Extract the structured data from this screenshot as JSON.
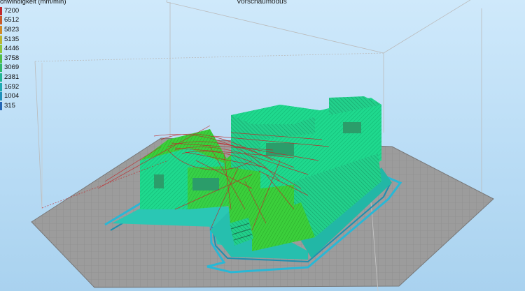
{
  "window": {
    "mode_title": "Vorschaumodus"
  },
  "legend": {
    "title": "chwindigkeit (mm/min)",
    "items": [
      {
        "value": "7200",
        "color": "#c0282b"
      },
      {
        "value": "6512",
        "color": "#c75a2a"
      },
      {
        "value": "5823",
        "color": "#cf8a29"
      },
      {
        "value": "5135",
        "color": "#b9b534"
      },
      {
        "value": "4446",
        "color": "#8cc63e"
      },
      {
        "value": "3758",
        "color": "#4fbf47"
      },
      {
        "value": "3069",
        "color": "#2fb86a"
      },
      {
        "value": "2381",
        "color": "#22b493"
      },
      {
        "value": "1692",
        "color": "#1fa9b2"
      },
      {
        "value": "1004",
        "color": "#1f8fba"
      },
      {
        "value": "315",
        "color": "#2466b5"
      }
    ]
  },
  "colors": {
    "background": "#bcdff7",
    "build_plate": "#9a9a9a",
    "infill": "#1fd98e",
    "travel": "#c0282b",
    "skirt": "#28b8d6"
  }
}
